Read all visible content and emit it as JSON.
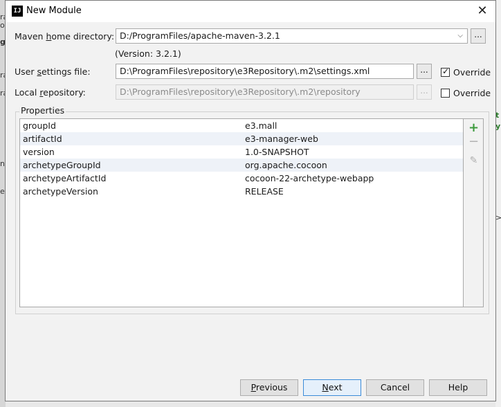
{
  "window": {
    "title": "New Module",
    "close_symbol": "✕"
  },
  "maven_home": {
    "label_pre": "Maven ",
    "label_u": "h",
    "label_post": "ome directory:",
    "value": "D:/ProgramFiles/apache-maven-3.2.1",
    "version": "(Version: 3.2.1)"
  },
  "user_settings": {
    "label_pre": "User ",
    "label_u": "s",
    "label_post": "ettings file:",
    "value": "D:\\ProgramFiles\\repository\\e3Repository\\.m2\\settings.xml",
    "override_label": "Override",
    "override_checked": true
  },
  "local_repo": {
    "label_pre": "Local ",
    "label_u": "r",
    "label_post": "epository:",
    "value": "D:\\ProgramFiles\\repository\\e3Repository\\.m2\\repository",
    "override_label": "Override",
    "override_checked": false
  },
  "browse_label": "...",
  "properties": {
    "title": "Properties",
    "rows": [
      {
        "name": "groupId",
        "value": "e3.mall"
      },
      {
        "name": "artifactId",
        "value": "e3-manager-web"
      },
      {
        "name": "version",
        "value": "1.0-SNAPSHOT"
      },
      {
        "name": "archetypeGroupId",
        "value": "org.apache.cocoon"
      },
      {
        "name": "archetypeArtifactId",
        "value": "cocoon-22-archetype-webapp"
      },
      {
        "name": "archetypeVersion",
        "value": "RELEASE"
      }
    ],
    "tools": {
      "add": "+",
      "remove": "−",
      "edit": "✎"
    }
  },
  "buttons": {
    "previous_u": "P",
    "previous_rest": "revious",
    "next_u": "N",
    "next_rest": "ext",
    "cancel": "Cancel",
    "help": "Help"
  },
  "background": {
    "glyphs": [
      "ra",
      "oc",
      "g",
      "ra",
      "ra",
      "nl",
      "es",
      "t",
      "y",
      ">"
    ]
  }
}
